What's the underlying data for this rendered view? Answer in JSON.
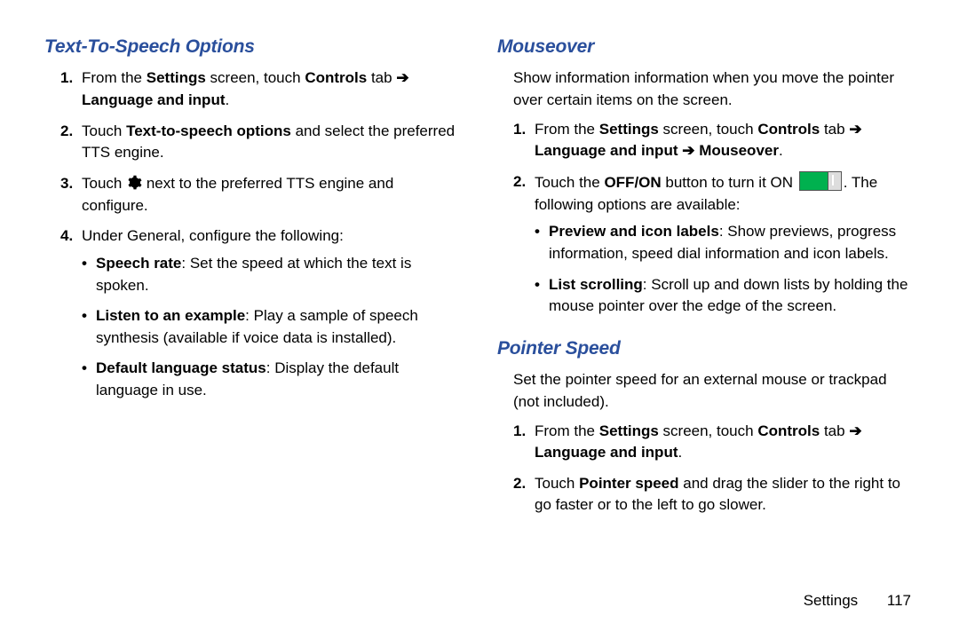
{
  "left": {
    "heading": "Text-To-Speech Options",
    "steps": [
      {
        "num": "1.",
        "html": "From the <b>Settings</b> screen, touch <b>Controls</b> tab <span class='arrow'>➔</span> <b>Language and input</b>."
      },
      {
        "num": "2.",
        "html": "Touch <b>Text-to-speech options</b> and select the preferred TTS engine."
      },
      {
        "num": "3.",
        "html": "Touch <svg class='gear' data-name='gear-icon' data-interactable='false' viewBox='0 0 24 24'><path fill='#000' d='M12 8a4 4 0 1 0 0 8 4 4 0 0 0 0-8zm9.4 4c0-.6-.1-1.2-.2-1.8l2.1-1.6-2-3.5-2.5 1a8 8 0 0 0-3.1-1.8L15.3 1h-4l-.4 2.7A8 8 0 0 0 7.8 5.5l-2.5-1-2 3.5 2.1 1.6a8 8 0 0 0 0 3.6l-2.1 1.6 2 3.5 2.5-1a8 8 0 0 0 3.1 1.8l.4 2.7h4l.4-2.7a8 8 0 0 0 3.1-1.8l2.5 1 2-3.5-2.1-1.6c.1-.6.2-1.2.2-1.8z'/></svg> next to the preferred TTS engine and configure."
      },
      {
        "num": "4.",
        "html": "Under General, configure the following:",
        "bullets": [
          "<b>Speech rate</b>: Set the speed at which the text is spoken.",
          "<b>Listen to an example</b>: Play a sample of speech synthesis (available if voice data is installed).",
          "<b>Default language status</b>: Display the default language in use."
        ]
      }
    ]
  },
  "right": {
    "sections": [
      {
        "heading": "Mouseover",
        "intro": "Show information information when you move the pointer over certain items on the screen.",
        "steps": [
          {
            "num": "1.",
            "html": "From the <b>Settings</b> screen, touch <b>Controls</b> tab <span class='arrow'>➔</span> <b>Language and input</b> <span class='arrow'>➔</span> <b>Mouseover</b>."
          },
          {
            "num": "2.",
            "html": "Touch the <b>OFF/ON</b> button to turn it ON <span class='toggle' data-name='on-toggle-icon' data-interactable='false'></span>. The following options are available:",
            "bullets": [
              "<b>Preview and icon labels</b>: Show previews, progress information, speed dial information and icon labels.",
              "<b>List scrolling</b>: Scroll up and down lists by holding the mouse pointer over the edge of the screen."
            ]
          }
        ]
      },
      {
        "heading": "Pointer Speed",
        "intro": "Set the pointer speed for an external mouse or trackpad (not included).",
        "steps": [
          {
            "num": "1.",
            "html": "From the <b>Settings</b> screen, touch <b>Controls</b> tab <span class='arrow'>➔</span> <b>Language and input</b>."
          },
          {
            "num": "2.",
            "html": "Touch <b>Pointer speed</b> and drag the slider to the right to go faster or to the left to go slower."
          }
        ]
      }
    ]
  },
  "footer": {
    "section": "Settings",
    "page": "117"
  }
}
